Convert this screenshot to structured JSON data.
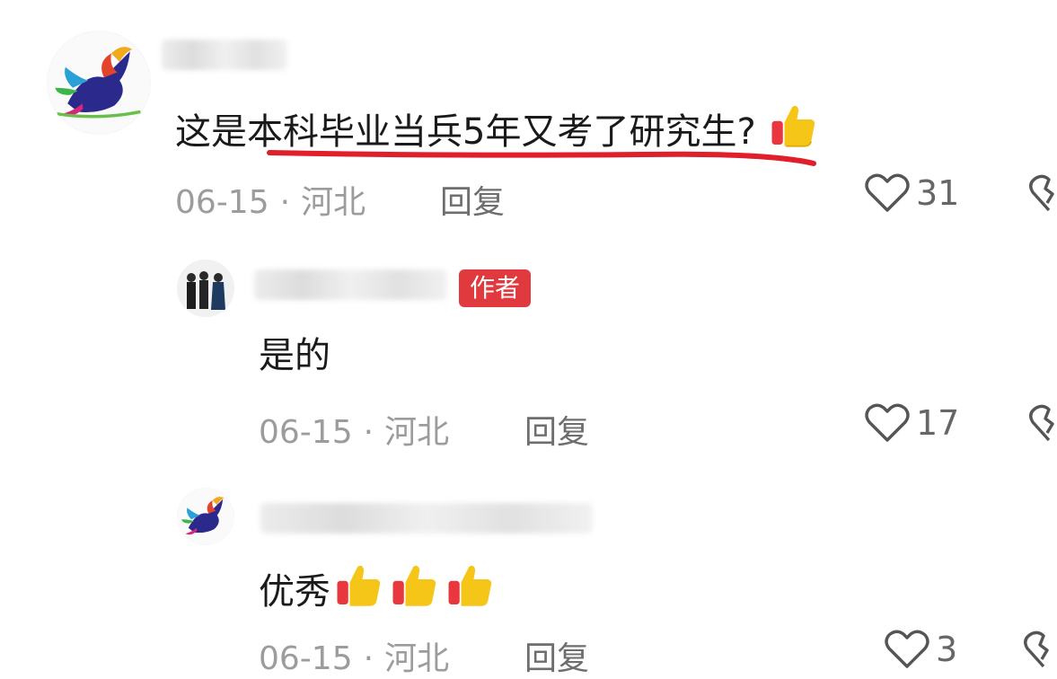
{
  "comments": [
    {
      "text": "这是本科毕业当兵5年又考了研究生?",
      "date": "06-15",
      "location": "河北",
      "reply_label": "回复",
      "likes": "31",
      "reaction": "thumbs-up-emoji"
    },
    {
      "author_tag": "作者",
      "text": "是的",
      "date": "06-15",
      "location": "河北",
      "reply_label": "回复",
      "likes": "17"
    },
    {
      "text": "优秀",
      "date": "06-15",
      "location": "河北",
      "reply_label": "回复",
      "likes": "3",
      "reactions": [
        "thumbs-up-emoji",
        "thumbs-up-emoji",
        "thumbs-up-emoji"
      ]
    }
  ],
  "separator": "·",
  "colors": {
    "author_tag": "#e0393e",
    "underline": "#e01f2a",
    "meta_text": "#9c9c9c"
  }
}
